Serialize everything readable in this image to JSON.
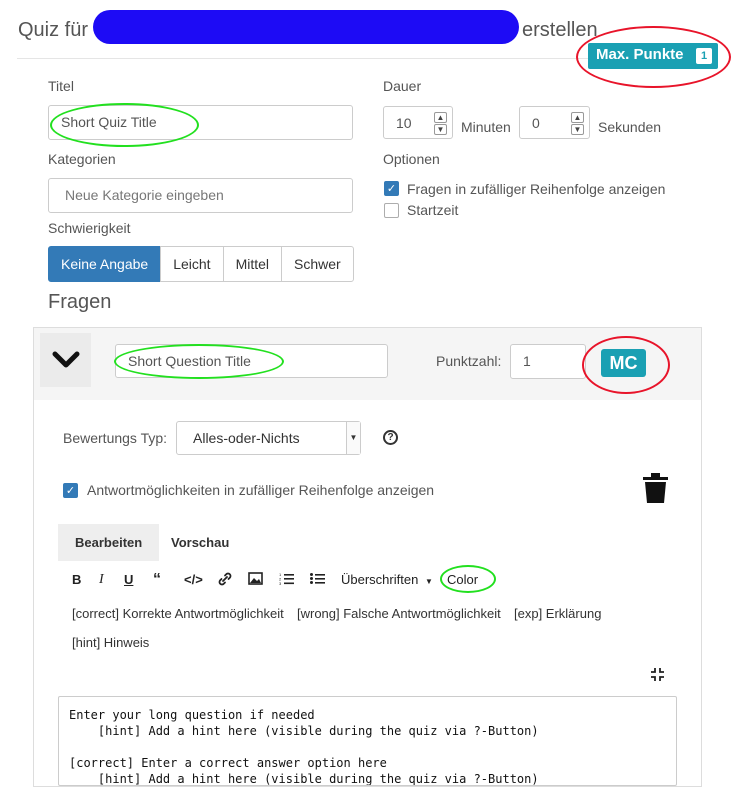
{
  "header": {
    "title_prefix": "Quiz für",
    "title_suffix": "erstellen",
    "max_points_label": "Max. Punkte",
    "max_points_count": "1"
  },
  "form": {
    "title_label": "Titel",
    "title_value": "Short Quiz Title",
    "category_label": "Kategorien",
    "category_placeholder": "Neue Kategorie eingeben",
    "difficulty_label": "Schwierigkeit",
    "difficulty_options": [
      "Keine Angabe",
      "Leicht",
      "Mittel",
      "Schwer"
    ],
    "duration_label": "Dauer",
    "minutes_value": "10",
    "minutes_label": "Minuten",
    "seconds_value": "0",
    "seconds_label": "Sekunden",
    "options_label": "Optionen",
    "random_order_label": "Fragen in zufälliger Reihenfolge anzeigen",
    "start_time_label": "Startzeit"
  },
  "questions": {
    "section_title": "Fragen",
    "question_title": "Short Question Title",
    "points_label": "Punktzahl:",
    "points_value": "1",
    "type_badge": "MC",
    "scoring_label": "Bewertungs Typ:",
    "scoring_value": "Alles-oder-Nichts",
    "shuffle_answers_label": "Antwortmöglichkeiten in zufälliger Reihenfolge anzeigen"
  },
  "editor": {
    "tab_edit": "Bearbeiten",
    "tab_preview": "Vorschau",
    "headings_label": "Überschriften",
    "color_label": "Color",
    "snippets": [
      "[correct] Korrekte Antwortmöglichkeit",
      "[wrong] Falsche Antwortmöglichkeit",
      "[exp] Erklärung",
      "[hint] Hinweis"
    ],
    "content": "Enter your long question if needed\n    [hint] Add a hint here (visible during the quiz via ?-Button)\n\n[correct] Enter a correct answer option here\n    [hint] Add a hint here (visible during the quiz via ?-Button)"
  },
  "colors": {
    "accent": "#1aa0b3",
    "primary": "#337ab7",
    "annotation_red": "#e8142a",
    "annotation_green": "#22e01f",
    "redaction_blue": "#1d0bf5"
  }
}
